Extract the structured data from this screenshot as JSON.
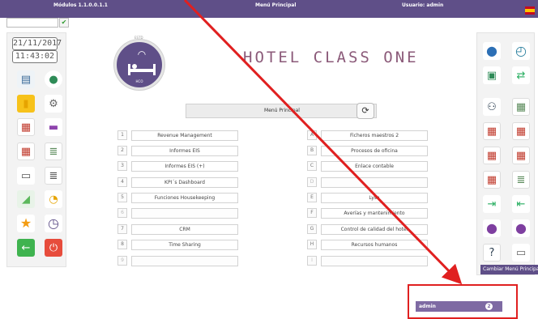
{
  "header": {
    "module_label": "Módulos 1.1.0.0.1.1",
    "screen_title": "Menú Principal",
    "user_label": "Usuario: admin",
    "search_value": "",
    "confirm_glyph": "✔"
  },
  "clock": {
    "date": "21/11/2017",
    "time": "11:43:02"
  },
  "logo": {
    "tagline": "ESTD",
    "small_text": "HCO"
  },
  "hotel_title": "HOTEL CLASS ONE",
  "menu_caption": "Menú Principal",
  "menu": {
    "left": [
      {
        "key": "1",
        "label": "Revenue Management"
      },
      {
        "key": "2",
        "label": "Informes EIS"
      },
      {
        "key": "3",
        "label": "Informes EIS (+)"
      },
      {
        "key": "4",
        "label": "KPI´s Dashboard"
      },
      {
        "key": "5",
        "label": "Funciones Housekeeping"
      },
      {
        "key": "6",
        "label": ""
      },
      {
        "key": "7",
        "label": "CRM"
      },
      {
        "key": "8",
        "label": "Time Sharing"
      },
      {
        "key": "9",
        "label": ""
      }
    ],
    "right": [
      {
        "key": "A",
        "label": "Ficheros maestros 2"
      },
      {
        "key": "B",
        "label": "Procesos de oficina"
      },
      {
        "key": "C",
        "label": "Enlace contable"
      },
      {
        "key": "D",
        "label": ""
      },
      {
        "key": "E",
        "label": "Lysa"
      },
      {
        "key": "F",
        "label": "Averías y mantenimiento"
      },
      {
        "key": "G",
        "label": "Control de calidad del hotel"
      },
      {
        "key": "H",
        "label": "Recursos humanos"
      },
      {
        "key": "I",
        "label": ""
      }
    ]
  },
  "tooltip": "Cambiar Menú Principal",
  "user_panel": {
    "name": "admin",
    "badge": "2"
  },
  "colors": {
    "primary": "#5f4f88",
    "annotation_red": "#e02020",
    "title": "#8b5a79"
  }
}
